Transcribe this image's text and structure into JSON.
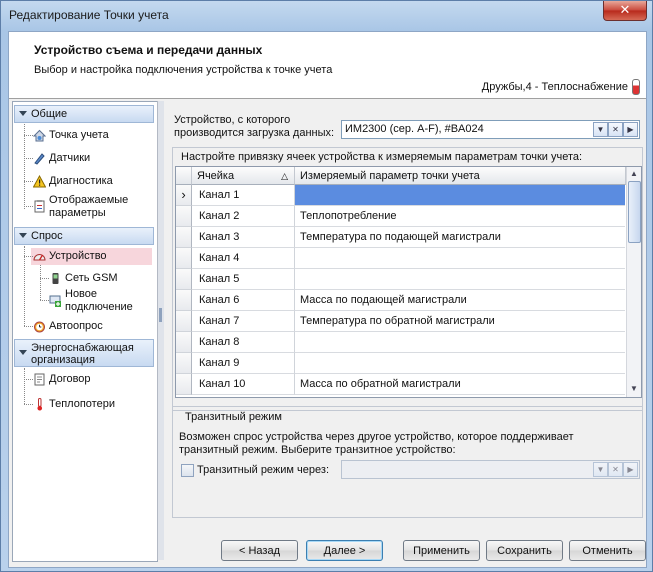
{
  "window": {
    "title": "Редактирование Точки учета",
    "close_glyph": "✕"
  },
  "header": {
    "title": "Устройство съема и передачи данных",
    "subtitle": "Выбор и настройка подключения устройства к точке учета",
    "context": "Дружбы,4 - Теплоснабжение"
  },
  "sidebar": {
    "groups": [
      "Общие",
      "Спрос",
      "Энергоснабжающая организация"
    ],
    "items": [
      {
        "label": "Точка учета",
        "icon": "house-gauge-icon"
      },
      {
        "label": "Датчики",
        "icon": "pen-sensor-icon"
      },
      {
        "label": "Диагностика",
        "icon": "warning-icon"
      },
      {
        "label": "Отображаемые параметры",
        "icon": "clipboard-icon"
      },
      {
        "label": "Устройство",
        "icon": "gauge-icon"
      },
      {
        "label": "Сеть GSM",
        "icon": "phone-icon"
      },
      {
        "label": "Новое подключение",
        "icon": "new-connection-icon"
      },
      {
        "label": "Автоопрос",
        "icon": "alarm-clock-icon"
      },
      {
        "label": "Договор",
        "icon": "contract-icon"
      },
      {
        "label": "Теплопотери",
        "icon": "thermometer-icon"
      }
    ]
  },
  "device": {
    "label": "Устройство, с которого производится загрузка данных:",
    "value": "ИМ2300 (сер. A-F), #BA024"
  },
  "binding": {
    "caption": "Настройте привязку ячеек устройства к измеряемым параметрам точки учета:",
    "col_cell": "Ячейка",
    "col_param": "Измеряемый параметр точки учета",
    "rows": [
      {
        "cell": "Канал 1",
        "param": ""
      },
      {
        "cell": "Канал 2",
        "param": "Теплопотребление"
      },
      {
        "cell": "Канал 3",
        "param": "Температура по подающей магистрали"
      },
      {
        "cell": "Канал 4",
        "param": ""
      },
      {
        "cell": "Канал 5",
        "param": ""
      },
      {
        "cell": "Канал 6",
        "param": "Масса по подающей магистрали"
      },
      {
        "cell": "Канал 7",
        "param": "Температура по обратной магистрали"
      },
      {
        "cell": "Канал 8",
        "param": ""
      },
      {
        "cell": "Канал 9",
        "param": ""
      },
      {
        "cell": "Канал 10",
        "param": "Масса по обратной магистрали"
      }
    ]
  },
  "transit": {
    "title": "Транзитный режим",
    "desc": "Возможен спрос устройства через другое устройство, которое поддерживает транзитный режим. Выберите транзитное устройство:",
    "checkbox_label": "Транзитный режим через:",
    "checked": false
  },
  "buttons": {
    "back": "< Назад",
    "next": "Далее >",
    "apply": "Применить",
    "save": "Сохранить",
    "cancel": "Отменить"
  },
  "colors": {
    "selection": "#f7d6dc",
    "row_highlight": "#5b8ce0",
    "title_gradient": "#b9d1ec"
  }
}
